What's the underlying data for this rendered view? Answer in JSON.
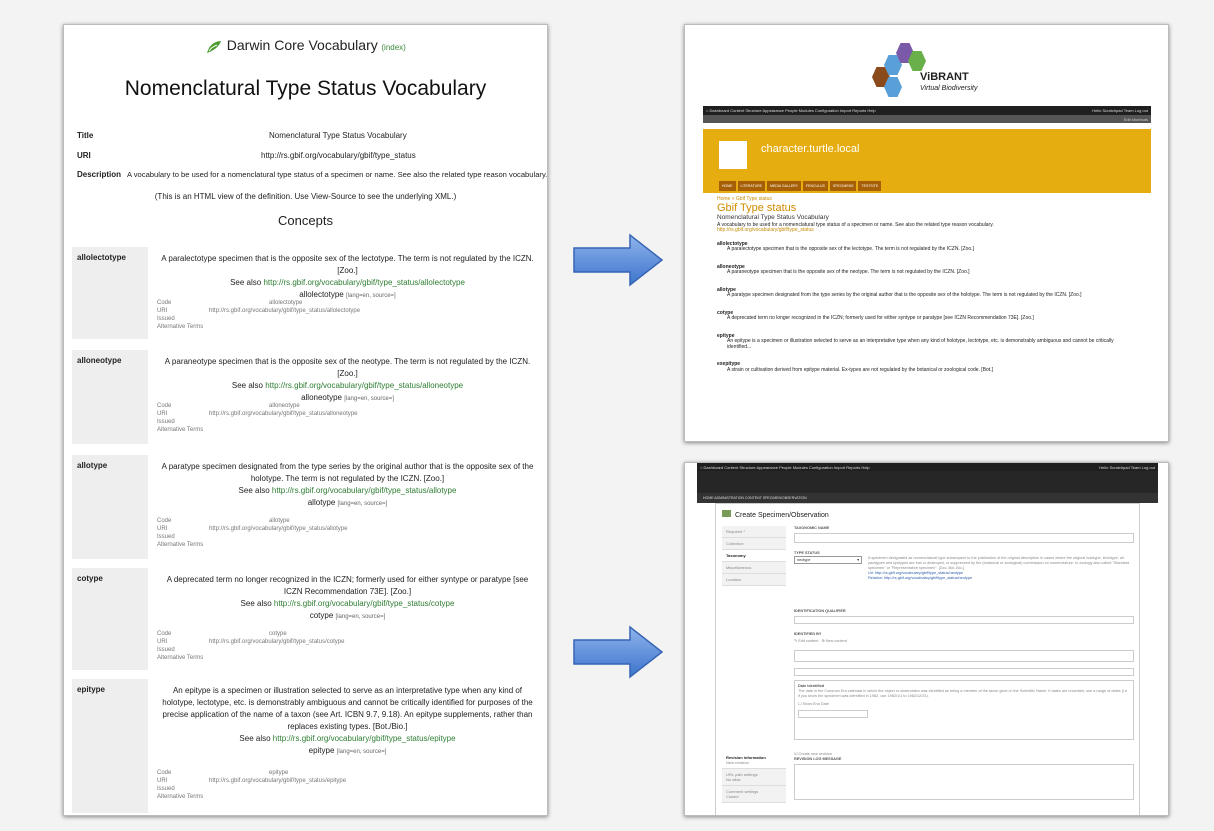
{
  "doc": {
    "logo_text": "Darwin Core Vocabulary",
    "index_link": "(index)",
    "title": "Nomenclatural Type Status Vocabulary",
    "meta": [
      {
        "k": "Title",
        "v": "Nomenclatural Type Status Vocabulary"
      },
      {
        "k": "URI",
        "v": "http://rs.gbif.org/vocabulary/gbif/type_status"
      },
      {
        "k": "Description",
        "v": "A vocabulary to be used for a nomenclatural type status of a specimen or name. See also the related type reason vocabulary."
      }
    ],
    "note": "(This is an HTML view of the definition. Use View-Source to see the underlying XML.)",
    "concepts_heading": "Concepts",
    "see_also": "See also",
    "code_label": "Code",
    "uri_label": "URI",
    "issued_label": "Issued",
    "alt_label": "Alternative Terms",
    "lang_note": "[lang=en, source=]",
    "terms": [
      {
        "name": "allolectotype",
        "desc": "A paralectotype specimen that is the opposite sex of the lectotype. The term is not regulated by the ICZN. [Zoo.]",
        "uri": "http://rs.gbif.org/vocabulary/gbif/type_status/allolectotype"
      },
      {
        "name": "alloneotype",
        "desc": "A paraneotype specimen that is the opposite sex of the neotype. The term is not regulated by the ICZN. [Zoo.]",
        "uri": "http://rs.gbif.org/vocabulary/gbif/type_status/alloneotype"
      },
      {
        "name": "allotype",
        "desc": "A paratype specimen designated from the type series by the original author that is the opposite sex of the holotype. The term is not regulated by the ICZN. [Zoo.]",
        "uri": "http://rs.gbif.org/vocabulary/gbif/type_status/allotype"
      },
      {
        "name": "cotype",
        "desc": "A deprecated term no longer recognized in the ICZN; formerly used for either syntype or paratype [see ICZN Recommendation 73E]. [Zoo.]",
        "uri": "http://rs.gbif.org/vocabulary/gbif/type_status/cotype"
      },
      {
        "name": "epitype",
        "desc": "An epitype is a specimen or illustration selected to serve as an interpretative type when any kind of holotype, lectotype, etc. is demonstrably ambiguous and cannot be critically identified for purposes of the precise application of the name of a taxon (see Art. ICBN 9.7, 9.18). An epitype supplements, rather than replaces existing types. [Bot./Bio.]",
        "uri": "http://rs.gbif.org/vocabulary/gbif/type_status/epitype"
      }
    ]
  },
  "vibrant": {
    "name": "ViBRANT",
    "tagline": "Virtual Biodiversity"
  },
  "drupal": {
    "toolbar": "Dashboard   Content   Structure   Appearance   People   Modules   Configuration   Import   Reports   Help",
    "user": "Hello Scratchpad Team   Log out",
    "shortcuts": "Edit shortcuts",
    "site_name": "character.turtle.local",
    "nav": [
      "HOME",
      "LITERATURE",
      "MEDIA GALLERY",
      "FENCULUS",
      "SPECIMENS",
      "TESTSITE"
    ],
    "breadcrumb": "Home » Gbif Type status",
    "page_title": "Gbif Type status",
    "vocab_title": "Nomenclatural Type Status Vocabulary",
    "vocab_desc": "A vocabulary to be used for a nomenclatural type status of a specimen or name. See also the related type reason vocabulary.",
    "vocab_uri": "http://rs.gbif.org/vocabulary/gbif/type_status",
    "entries": [
      {
        "name": "allolectotype",
        "desc": "A paralectotype specimen that is the opposite sex of the lectotype. The term is not regulated by the ICZN. [Zoo.]"
      },
      {
        "name": "alloneotype",
        "desc": "A paraneotype specimen that is the opposite sex of the neotype. The term is not regulated by the ICZN. [Zoo.]"
      },
      {
        "name": "allotype",
        "desc": "A paratype specimen designated from the type series by the original author that is the opposite sex of the holotype. The term is not regulated by the ICZN. [Zoo.]"
      },
      {
        "name": "cotype",
        "desc": "A deprecated term no longer recognized in the ICZN; formerly used for either syntype or paratype [see ICZN Recommendation 73E]. [Zoo.]"
      },
      {
        "name": "epitype",
        "desc": "An epitype is a specimen or illustration selected to serve as an interpretative type when any kind of holotype, lectotype, etc. is demonstrably ambiguous and cannot be critically identified..."
      },
      {
        "name": "exepitype",
        "desc": "A strain or cultivation derived from epitype material. Ex-types are not regulated by the botanical or zoological code. [Bot.]"
      }
    ]
  },
  "form": {
    "tabs": "HOME    ADMINISTRATION    CONTENT    SPECIMEN/OBSERVATION",
    "title": "Create Specimen/Observation",
    "side": [
      "Required *",
      "Collection",
      "Taxonomy",
      "Miscellaneous",
      "Location"
    ],
    "taxonomic_name": "TAXONOMIC NAME",
    "type_status": "TYPE STATUS",
    "type_value": "neotype",
    "type_help": "A specimen designated as nomenclatural type subsequent to the publication of the original description in cases where the original holotype, lectotype, all paratypes and syntypes are lost or destroyed, or suppressed by the (botanical or zoological) commission on nomenclature. In zoology also called \"Standard specimen\" or \"Representative specimen\". [Zoo.,Bot.,Bio.]",
    "type_uri": "Uri: http://rs.gbif.org/vocabulary/gbif/type_status/neotype",
    "type_rel": "Relation: http://rs.gbif.org/vocabulary/gbif/type_status/neotype",
    "ident_qual": "IDENTIFICATION QUALIFIER",
    "ident_by": "IDENTIFIED BY",
    "edit_content": "Edit content",
    "new_content": "New content",
    "date_identified": "Date Identified",
    "date_help": "The date in the Common Era calendar in which the object or observation was identified as being a member of the taxon given in the Scientific Name. If dates are uncertain, use a range of dates (i.e. if you know the specimen was identified in 1982, use 1982/1/1 to 1982/12/31).",
    "show_end": "Show End Date",
    "rev_info": "Revision information",
    "rev_sub": "New revision",
    "url_path": "URL path settings",
    "url_sub": "No alias",
    "comment": "Comment settings",
    "comment_sub": "Closed",
    "create_rev": "Create new revision",
    "rev_log": "REVISION LOG MESSAGE"
  }
}
